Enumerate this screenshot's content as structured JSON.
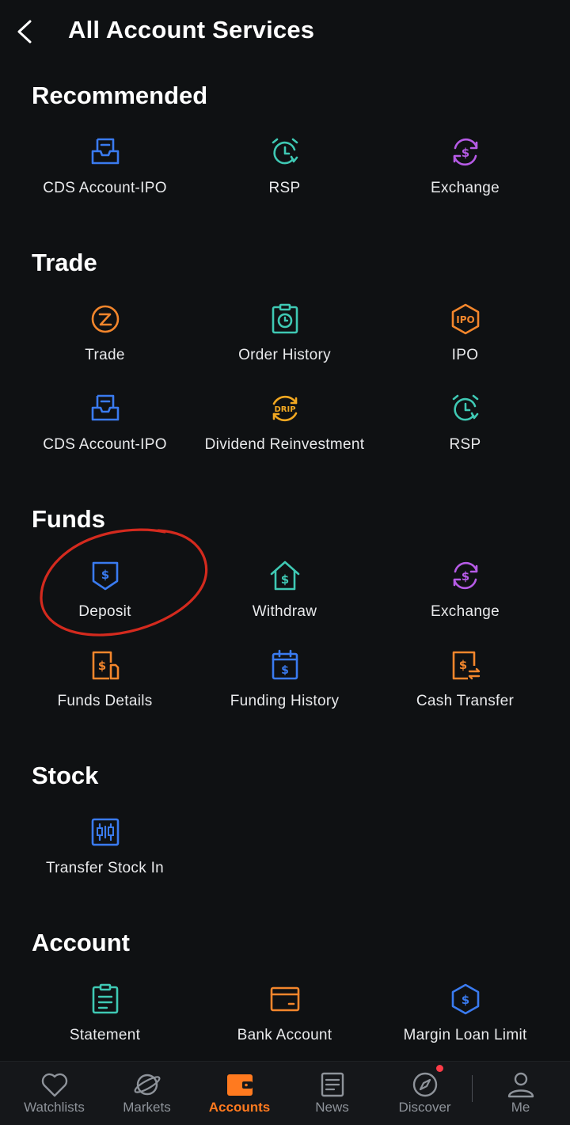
{
  "header": {
    "title": "All Account Services"
  },
  "sections": {
    "recommended": {
      "title": "Recommended",
      "items": [
        {
          "label": "CDS Account-IPO",
          "icon": "inbox-icon"
        },
        {
          "label": "RSP",
          "icon": "alarm-clock-icon"
        },
        {
          "label": "Exchange",
          "icon": "currency-exchange-icon"
        }
      ]
    },
    "trade": {
      "title": "Trade",
      "items": [
        {
          "label": "Trade",
          "icon": "trade-icon"
        },
        {
          "label": "Order History",
          "icon": "clipboard-clock-icon"
        },
        {
          "label": "IPO",
          "icon": "ipo-hexagon-icon"
        },
        {
          "label": "CDS Account-IPO",
          "icon": "inbox-icon"
        },
        {
          "label": "Dividend Reinvestment",
          "icon": "drip-icon"
        },
        {
          "label": "RSP",
          "icon": "alarm-clock-icon"
        }
      ]
    },
    "funds": {
      "title": "Funds",
      "items": [
        {
          "label": "Deposit",
          "icon": "deposit-shield-icon"
        },
        {
          "label": "Withdraw",
          "icon": "house-dollar-icon"
        },
        {
          "label": "Exchange",
          "icon": "currency-exchange-icon"
        },
        {
          "label": "Funds Details",
          "icon": "dollar-document-icon"
        },
        {
          "label": "Funding History",
          "icon": "dollar-calendar-icon"
        },
        {
          "label": "Cash Transfer",
          "icon": "dollar-transfer-icon"
        }
      ]
    },
    "stock": {
      "title": "Stock",
      "items": [
        {
          "label": "Transfer Stock In",
          "icon": "candlestick-chart-icon"
        }
      ]
    },
    "account": {
      "title": "Account",
      "items": [
        {
          "label": "Statement",
          "icon": "clipboard-list-icon"
        },
        {
          "label": "Bank Account",
          "icon": "bank-card-icon"
        },
        {
          "label": "Margin Loan Limit",
          "icon": "hexagon-dollar-icon"
        }
      ]
    }
  },
  "tabbar": {
    "items": [
      {
        "label": "Watchlists",
        "icon": "heart-icon"
      },
      {
        "label": "Markets",
        "icon": "planet-icon"
      },
      {
        "label": "Accounts",
        "icon": "wallet-icon",
        "active": true
      },
      {
        "label": "News",
        "icon": "news-icon"
      },
      {
        "label": "Discover",
        "icon": "compass-icon"
      },
      {
        "label": "Me",
        "icon": "person-icon"
      }
    ]
  },
  "colors": {
    "background": "#0f1113",
    "accent": "#ff7a1f",
    "blue": "#3a7bf0",
    "teal": "#3fc9b4",
    "purple": "#b65be6",
    "orange": "#f3862c",
    "annotation_red": "#d42a1e"
  }
}
